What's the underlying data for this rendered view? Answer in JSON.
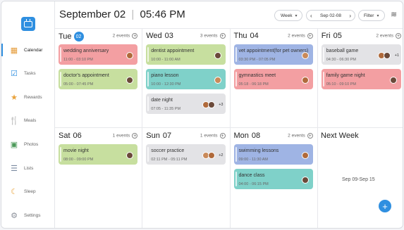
{
  "colors": {
    "accent": "#2f8fe0",
    "pink": "#f39fa2",
    "green": "#c7df9f",
    "blue": "#9fb4e4",
    "teal": "#7fd1c9",
    "gray": "#e3e3e6"
  },
  "sidebar": {
    "items": [
      {
        "label": "Calendar",
        "icon": "calendar-icon",
        "glyph": "▦"
      },
      {
        "label": "Tasks",
        "icon": "tasks-icon",
        "glyph": "☑"
      },
      {
        "label": "Rewards",
        "icon": "star-icon",
        "glyph": "★"
      },
      {
        "label": "Meals",
        "icon": "utensils-icon",
        "glyph": "🍴"
      },
      {
        "label": "Photos",
        "icon": "photos-icon",
        "glyph": "▣"
      },
      {
        "label": "Lists",
        "icon": "list-icon",
        "glyph": "☰"
      },
      {
        "label": "Sleep",
        "icon": "moon-icon",
        "glyph": "☾"
      },
      {
        "label": "Settings",
        "icon": "gear-icon",
        "glyph": "⚙"
      }
    ]
  },
  "header": {
    "date": "September 02",
    "time": "05:46 PM",
    "view": "Week",
    "range": "Sep 02-08",
    "filter": "Filter"
  },
  "days": [
    {
      "name": "Tue",
      "date": "02",
      "today": true,
      "count": "2 events",
      "events": [
        {
          "title": "wedding anniversary",
          "time": "11:00 - 03:10 PM",
          "color": "pink",
          "avatars": 1,
          "more": ""
        },
        {
          "title": "doctor's appointment",
          "time": "05:00 - 07:45 PM",
          "color": "green",
          "avatars": 1,
          "more": ""
        }
      ]
    },
    {
      "name": "Wed",
      "date": "03",
      "today": false,
      "count": "3 events",
      "events": [
        {
          "title": "dentist appointment",
          "time": "10:00 - 11:00 AM",
          "color": "green",
          "avatars": 1,
          "more": ""
        },
        {
          "title": "piano lesson",
          "time": "10:00 - 12:30 PM",
          "color": "teal",
          "avatars": 1,
          "more": ""
        },
        {
          "title": "date night",
          "time": "07:05 - 11:35 PM",
          "color": "gray",
          "avatars": 2,
          "more": "+3"
        }
      ]
    },
    {
      "name": "Thu",
      "date": "04",
      "today": false,
      "count": "2 events",
      "events": [
        {
          "title": "vet appointment(for pet owners)",
          "time": "03:30 PM - 07:05 PM",
          "color": "blue",
          "avatars": 1,
          "more": ""
        },
        {
          "title": "gymnastics meet",
          "time": "05:18 - 06:18 PM",
          "color": "pink",
          "avatars": 1,
          "more": ""
        }
      ]
    },
    {
      "name": "Fri",
      "date": "05",
      "today": false,
      "count": "2 events",
      "events": [
        {
          "title": "baseball game",
          "time": "04:30 - 06:30 PM",
          "color": "gray",
          "avatars": 2,
          "more": "+1"
        },
        {
          "title": "family game night",
          "time": "05:10 - 09:10 PM",
          "color": "pink",
          "avatars": 1,
          "more": ""
        }
      ]
    },
    {
      "name": "Sat",
      "date": "06",
      "today": false,
      "count": "1 events",
      "events": [
        {
          "title": "movie night",
          "time": "08:00 - 09:00 PM",
          "color": "green",
          "avatars": 1,
          "more": ""
        }
      ]
    },
    {
      "name": "Sun",
      "date": "07",
      "today": false,
      "count": "1 events",
      "events": [
        {
          "title": "soccer practice",
          "time": "02:11 PM - 05:11 PM",
          "color": "gray",
          "avatars": 2,
          "more": "+2"
        }
      ]
    },
    {
      "name": "Mon",
      "date": "08",
      "today": false,
      "count": "2 events",
      "events": [
        {
          "title": "swimming lessons",
          "time": "09:00 - 11:30 AM",
          "color": "blue",
          "avatars": 1,
          "more": ""
        },
        {
          "title": "dance class",
          "time": "04:00 - 06:15 PM",
          "color": "teal",
          "avatars": 1,
          "more": ""
        }
      ]
    }
  ],
  "next_week": {
    "title": "Next Week",
    "range": "Sep 09-Sep 15"
  },
  "fab": {
    "label": "+"
  }
}
